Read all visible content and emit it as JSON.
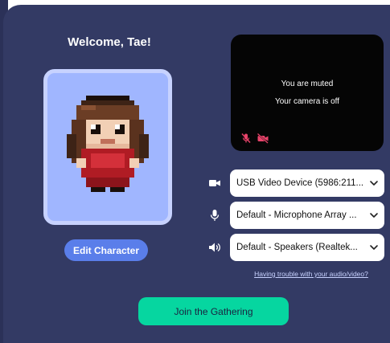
{
  "welcome": {
    "title": "Welcome, Tae!"
  },
  "avatar": {
    "edit_label": "Edit Character"
  },
  "preview": {
    "muted_text": "You are muted",
    "camera_text": "Your camera is off",
    "icons": [
      "mic-off-icon",
      "camera-off-icon"
    ]
  },
  "devices": {
    "camera": {
      "icon": "video-camera-icon",
      "value": "USB Video Device (5986:211..."
    },
    "microphone": {
      "icon": "microphone-icon",
      "value": "Default - Microphone Array ..."
    },
    "speakers": {
      "icon": "speaker-icon",
      "value": "Default - Speakers (Realtek..."
    }
  },
  "help": {
    "trouble_link": "Having trouble with your audio/video?"
  },
  "join": {
    "label": "Join the Gathering"
  },
  "colors": {
    "panel_bg": "#333a64",
    "avatar_bg": "#a0b6ff",
    "edit_button": "#5a7eea",
    "join_button": "#06d6a0",
    "muted_icon": "#e8436a"
  }
}
